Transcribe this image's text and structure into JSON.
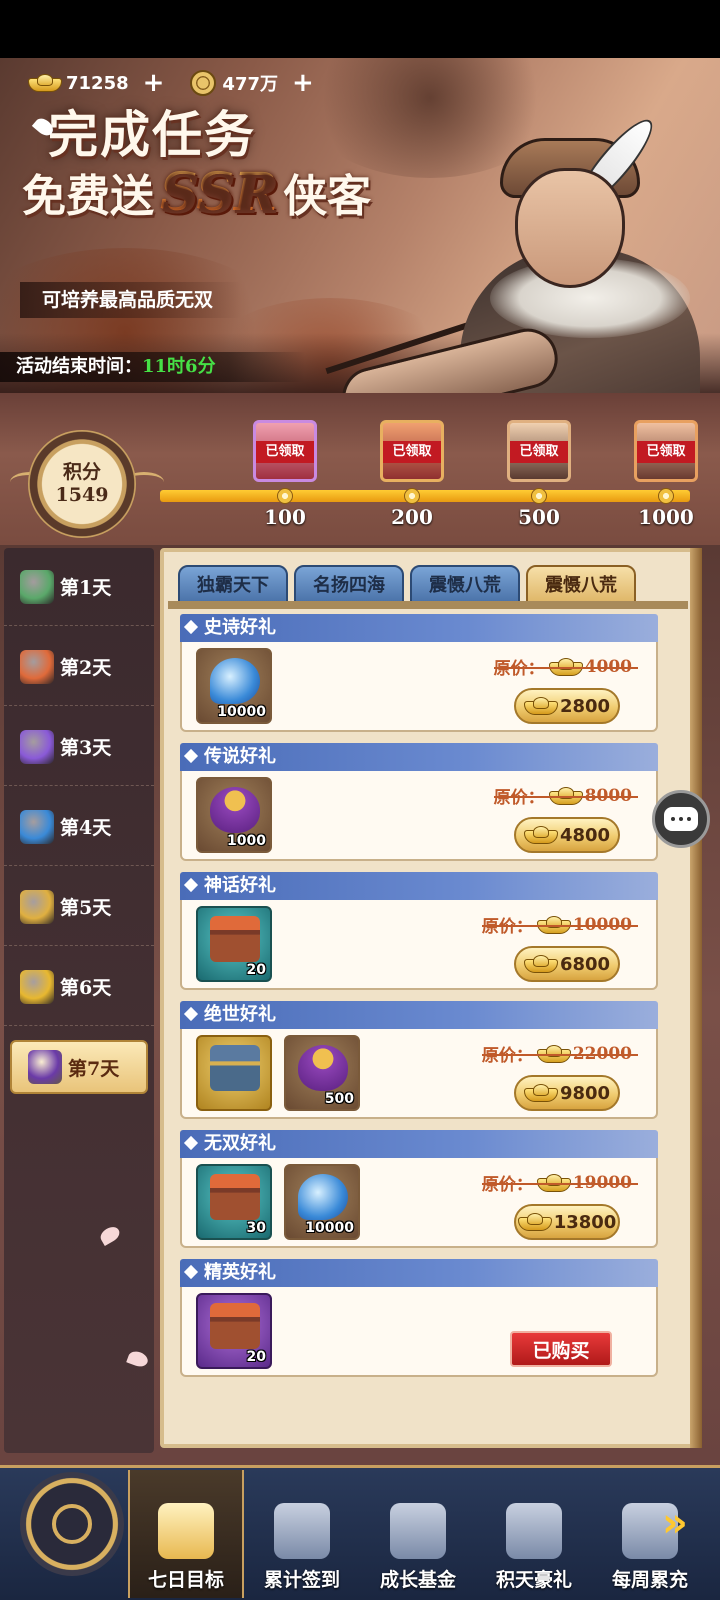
{
  "currency": {
    "gold_value": "71258",
    "coin_value": "477万",
    "plus_symbol": "+"
  },
  "banner": {
    "title": "完成任务",
    "subtitle_pre": "免费送",
    "subtitle_ssr": "SSR",
    "subtitle_post": "侠客",
    "tagline": "可培养最高品质无双",
    "timer_label": "活动结束时间：",
    "timer_value": "11时6分"
  },
  "points": {
    "label": "积分",
    "value": "1549",
    "progress": 1.0,
    "milestones": [
      {
        "value": "100",
        "status": "已领取",
        "color": "purple"
      },
      {
        "value": "200",
        "status": "已领取",
        "color": "orange"
      },
      {
        "value": "500",
        "status": "已领取",
        "color": "brown"
      },
      {
        "value": "1000",
        "status": "已领取",
        "color": "red"
      }
    ]
  },
  "sidebar": {
    "days": [
      {
        "label": "第1天",
        "icon": "scroll-icon",
        "color": "#5aa86a"
      },
      {
        "label": "第2天",
        "icon": "letter-icon",
        "color": "#e06a3a"
      },
      {
        "label": "第3天",
        "icon": "gem-icon",
        "color": "#8a5ad8"
      },
      {
        "label": "第4天",
        "icon": "crystal-icon",
        "color": "#3a8ad8"
      },
      {
        "label": "第5天",
        "icon": "orb-icon",
        "color": "#e0b040"
      },
      {
        "label": "第6天",
        "icon": "ingot-icon",
        "color": "#e8b830"
      },
      {
        "label": "第7天",
        "icon": "purple-orb-icon",
        "color": "#6a3aa8",
        "active": true
      }
    ]
  },
  "tabs": [
    {
      "label": "独霸天下",
      "active": false
    },
    {
      "label": "名扬四海",
      "active": false
    },
    {
      "label": "震慑八荒",
      "active": false
    },
    {
      "label": "震慑八荒",
      "active": true
    }
  ],
  "gifts": [
    {
      "title": "史诗好礼",
      "items": [
        {
          "icon": "potion-icon",
          "style": "brown",
          "glyph": "flask",
          "qty": "10000"
        }
      ],
      "orig_label": "原价：",
      "orig_price": "4000",
      "price": "2800",
      "bought": false
    },
    {
      "title": "传说好礼",
      "items": [
        {
          "icon": "treasure-bag-icon",
          "style": "brown",
          "glyph": "bag",
          "qty": "1000"
        }
      ],
      "orig_label": "原价：",
      "orig_price": "8000",
      "price": "4800",
      "bought": false
    },
    {
      "title": "神话好礼",
      "items": [
        {
          "icon": "treasure-chest-icon",
          "style": "teal",
          "glyph": "box",
          "qty": "20"
        }
      ],
      "orig_label": "原价：",
      "orig_price": "10000",
      "price": "6800",
      "bought": false
    },
    {
      "title": "绝世好礼",
      "items": [
        {
          "icon": "golden-chest-icon",
          "style": "gold",
          "glyph": "boxgold",
          "qty": ""
        },
        {
          "icon": "treasure-bag-icon",
          "style": "brown",
          "glyph": "bag",
          "qty": "500"
        }
      ],
      "orig_label": "原价：",
      "orig_price": "22000",
      "price": "9800",
      "bought": false
    },
    {
      "title": "无双好礼",
      "items": [
        {
          "icon": "treasure-chest-icon",
          "style": "teal",
          "glyph": "box",
          "qty": "30"
        },
        {
          "icon": "potion-icon",
          "style": "brown",
          "glyph": "flask",
          "qty": "10000"
        }
      ],
      "orig_label": "原价：",
      "orig_price": "19000",
      "price": "13800",
      "bought": false
    },
    {
      "title": "精英好礼",
      "items": [
        {
          "icon": "treasure-chest-icon",
          "style": "purple",
          "glyph": "box",
          "qty": "20"
        }
      ],
      "bought": true,
      "bought_label": "已购买"
    }
  ],
  "bottom_nav": {
    "items": [
      {
        "label": "七日目标",
        "icon": "seven-day-icon",
        "active": true
      },
      {
        "label": "累计签到",
        "icon": "sign-in-icon",
        "active": false
      },
      {
        "label": "成长基金",
        "icon": "fund-coins-icon",
        "active": false
      },
      {
        "label": "积天豪礼",
        "icon": "gift-box-icon",
        "active": false
      },
      {
        "label": "每周累充",
        "icon": "money-bag-icon",
        "active": false
      }
    ],
    "more_arrow": "»"
  }
}
